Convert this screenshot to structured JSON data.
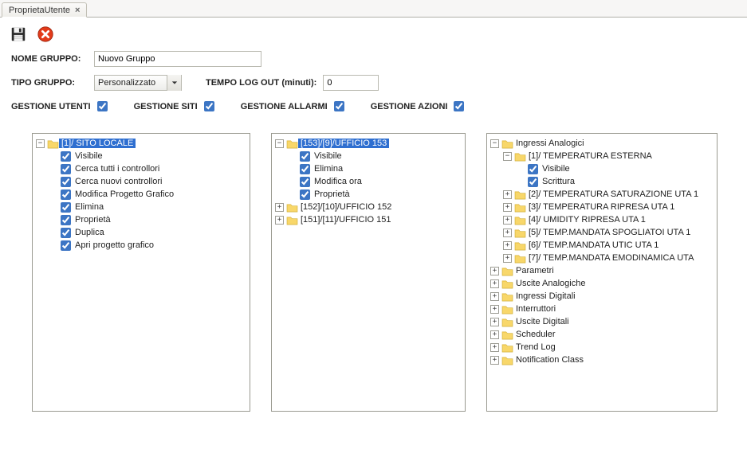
{
  "tab": {
    "label": "ProprietaUtente"
  },
  "form": {
    "name_label": "NOME GRUPPO:",
    "name_value": "Nuovo Gruppo",
    "type_label": "TIPO GRUPPO:",
    "type_value": "Personalizzato",
    "timeout_label": "TEMPO LOG OUT (minuti):",
    "timeout_value": "0"
  },
  "flags": {
    "users": "GESTIONE UTENTI",
    "sites": "GESTIONE SITI",
    "alarms": "GESTIONE ALLARMI",
    "actions": "GESTIONE AZIONI"
  },
  "tree1": {
    "root": "[1]/ SITO LOCALE",
    "items": [
      "Visibile",
      "Cerca tutti i controllori",
      "Cerca nuovi controllori",
      "Modifica Progetto Grafico",
      "Elimina",
      "Proprietà",
      "Duplica",
      "Apri progetto grafico"
    ]
  },
  "tree2": {
    "root": "[153]/[9]/UFFICIO 153",
    "items": [
      "Visibile",
      "Elimina",
      "Modifica ora",
      "Proprietà"
    ],
    "siblings": [
      "[152]/[10]/UFFICIO 152",
      "[151]/[11]/UFFICIO 151"
    ]
  },
  "tree3": {
    "root": "Ingressi Analogici",
    "first_child": "[1]/ TEMPERATURA ESTERNA",
    "first_child_items": [
      "Visibile",
      "Scrittura"
    ],
    "children": [
      "[2]/ TEMPERATURA SATURAZIONE UTA 1",
      "[3]/ TEMPERATURA RIPRESA UTA 1",
      "[4]/ UMIDITY RIPRESA UTA 1",
      "[5]/ TEMP.MANDATA SPOGLIATOI UTA 1",
      "[6]/ TEMP.MANDATA UTIC UTA 1",
      "[7]/ TEMP.MANDATA EMODINAMICA UTA"
    ],
    "siblings": [
      "Parametri",
      "Uscite Analogiche",
      "Ingressi Digitali",
      "Interruttori",
      "Uscite Digitali",
      "Scheduler",
      "Trend Log",
      "Notification Class"
    ]
  }
}
